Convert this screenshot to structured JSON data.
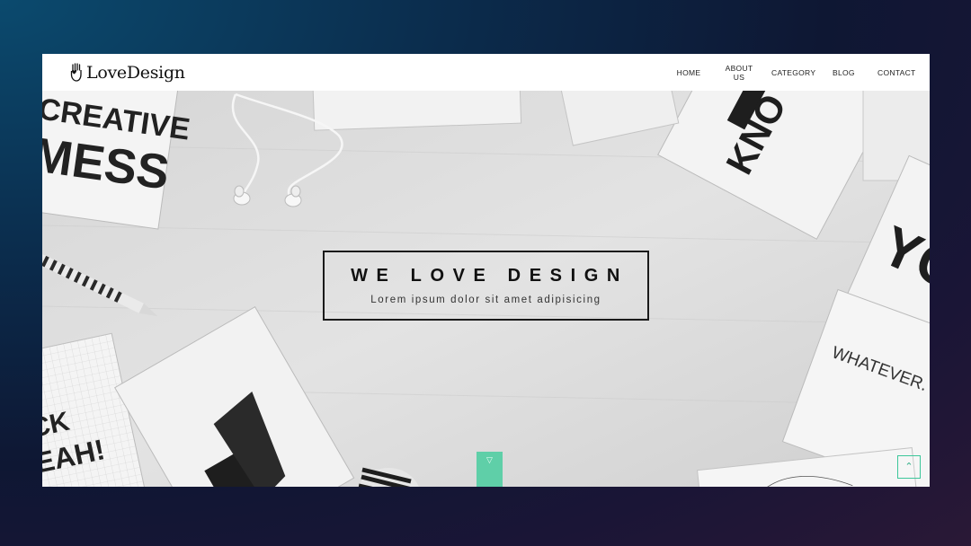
{
  "brand": {
    "logo_text": "LoveDesign",
    "logo_icon": "hand-heart-icon"
  },
  "nav": {
    "items": [
      {
        "label": "HOME"
      },
      {
        "label": "ABOUT US"
      },
      {
        "label": "CATEGORY"
      },
      {
        "label": "BLOG"
      },
      {
        "label": "CONTACT"
      }
    ]
  },
  "hero": {
    "title": "WE LOVE DESIGN",
    "subtitle": "Lorem ipsum dolor sit amet adipisicing",
    "background_cards": [
      "CREATIVE",
      "MESS",
      "KNO",
      "YO",
      "WHATEVER. F",
      "CK",
      "EAH!"
    ]
  },
  "controls": {
    "scroll_down_icon": "chevron-down-icon",
    "back_to_top_icon": "double-chevron-up-icon"
  },
  "colors": {
    "accent": "#5fcfa8",
    "page_bg_start": "#0b4a6e",
    "page_bg_end": "#2a1836",
    "hero_bg": "#dcdcdc",
    "text_dark": "#111111"
  }
}
